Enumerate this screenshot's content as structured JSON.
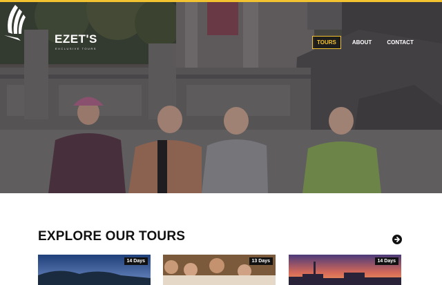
{
  "brand": {
    "name": "EZET'S",
    "tagline": "EXCLUSIVE TOURS",
    "accent": "#f2c230"
  },
  "nav": {
    "items": [
      {
        "label": "TOURS",
        "active": true
      },
      {
        "label": "ABOUT",
        "active": false
      },
      {
        "label": "CONTACT",
        "active": false
      }
    ]
  },
  "hero": {
    "description_icon": "hero-photo"
  },
  "tours_section": {
    "title": "EXPLORE OUR TOURS",
    "next_icon": "arrow-right-circle-icon",
    "cards": [
      {
        "duration": "14 Days"
      },
      {
        "duration": "13 Days"
      },
      {
        "duration": "14 Days"
      }
    ]
  }
}
